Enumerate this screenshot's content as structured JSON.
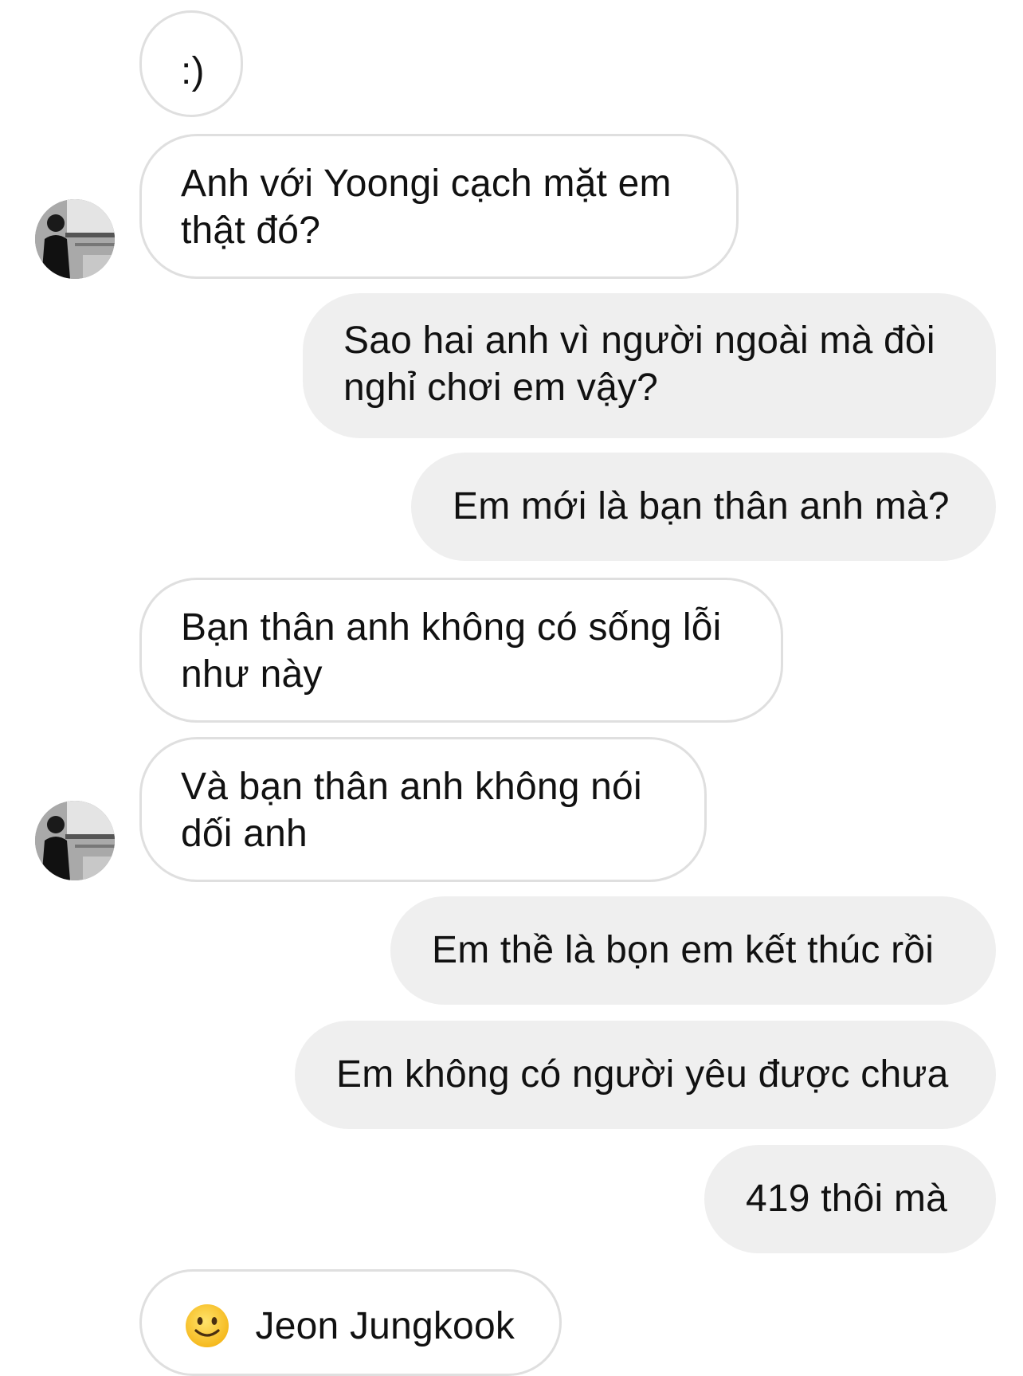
{
  "messages": [
    {
      "id": "m1",
      "side": "in",
      "lines": [
        ":)"
      ]
    },
    {
      "id": "m2",
      "side": "in",
      "lines": [
        "Anh với Yoongi cạch mặt em",
        "thật đó?"
      ]
    },
    {
      "id": "m3",
      "side": "out",
      "lines": [
        "Sao hai anh vì người ngoài mà đòi",
        "nghỉ chơi em vậy?"
      ]
    },
    {
      "id": "m4",
      "side": "out",
      "lines": [
        "Em mới là bạn thân anh mà?"
      ]
    },
    {
      "id": "m5",
      "side": "in",
      "lines": [
        "Bạn thân anh không có sống lỗi",
        "như này"
      ]
    },
    {
      "id": "m6",
      "side": "in",
      "lines": [
        "Và bạn thân anh không nói",
        "dối anh"
      ]
    },
    {
      "id": "m7",
      "side": "out",
      "lines": [
        "Em thề là bọn em kết thúc rồi"
      ]
    },
    {
      "id": "m8",
      "side": "out",
      "lines": [
        "Em không có người yêu được chưa"
      ]
    },
    {
      "id": "m9",
      "side": "out",
      "lines": [
        "419 thôi mà"
      ]
    },
    {
      "id": "m10",
      "side": "in",
      "emoji": "slightly-smiling-face-icon",
      "lines": [
        "Jeon Jungkook"
      ]
    }
  ],
  "avatars": [
    {
      "icon": "contact-avatar-photo"
    },
    {
      "icon": "contact-avatar-photo"
    }
  ],
  "colors": {
    "incoming_bg": "#ffffff",
    "incoming_border": "#dfdfdf",
    "outgoing_bg": "#efefef",
    "text": "#111111"
  }
}
